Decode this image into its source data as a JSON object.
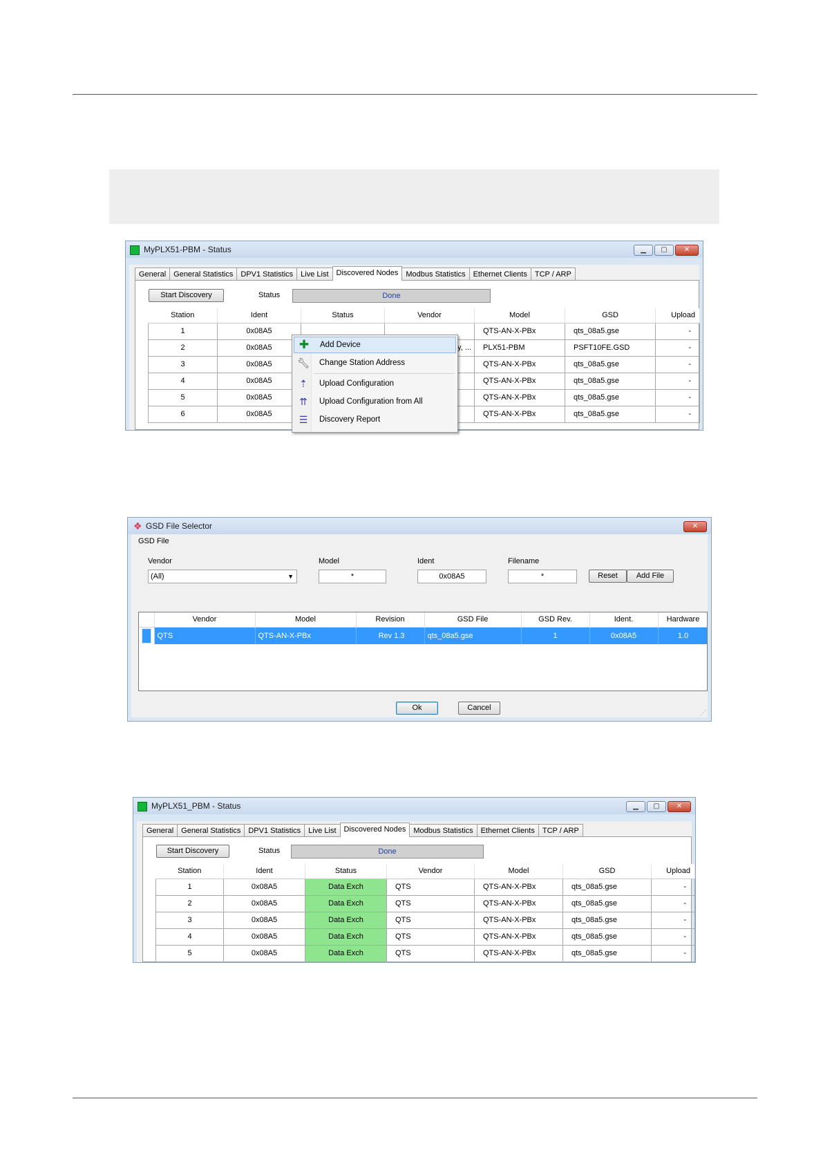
{
  "win1": {
    "title": "MyPLX51-PBM - Status",
    "tabs": [
      "General",
      "General Statistics",
      "DPV1 Statistics",
      "Live List",
      "Discovered Nodes",
      "Modbus Statistics",
      "Ethernet Clients",
      "TCP / ARP"
    ],
    "active_tab": "Discovered Nodes",
    "start_discovery_label": "Start Discovery",
    "status_label": "Status",
    "status_value": "Done",
    "columns": [
      "Station",
      "Ident",
      "Status",
      "Vendor",
      "Model",
      "GSD",
      "Upload"
    ],
    "rows": [
      {
        "station": "1",
        "ident": "0x08A5",
        "status": "",
        "vendor": "",
        "model": "QTS-AN-X-PBx",
        "gsd": "qts_08a5.gse",
        "upload": "-"
      },
      {
        "station": "2",
        "ident": "0x08A5",
        "status": "",
        "vendor": "gy, ...",
        "model": "PLX51-PBM",
        "gsd": "PSFT10FE.GSD",
        "upload": "-"
      },
      {
        "station": "3",
        "ident": "0x08A5",
        "status": "",
        "vendor": "",
        "model": "QTS-AN-X-PBx",
        "gsd": "qts_08a5.gse",
        "upload": "-"
      },
      {
        "station": "4",
        "ident": "0x08A5",
        "status": "",
        "vendor": "",
        "model": "QTS-AN-X-PBx",
        "gsd": "qts_08a5.gse",
        "upload": "-"
      },
      {
        "station": "5",
        "ident": "0x08A5",
        "status": "",
        "vendor": "",
        "model": "QTS-AN-X-PBx",
        "gsd": "qts_08a5.gse",
        "upload": "-"
      },
      {
        "station": "6",
        "ident": "0x08A5",
        "status": "",
        "vendor": "",
        "model": "QTS-AN-X-PBx",
        "gsd": "qts_08a5.gse",
        "upload": "-"
      }
    ],
    "context_menu": [
      {
        "label": "Add Device",
        "icon": "green-plus-icon"
      },
      {
        "label": "Change Station Address",
        "icon": "wrench-icon"
      },
      {
        "label": "Upload Configuration",
        "icon": "upload-icon"
      },
      {
        "label": "Upload Configuration from All",
        "icon": "upload-all-icon"
      },
      {
        "label": "Discovery Report",
        "icon": "report-icon"
      }
    ]
  },
  "gsd": {
    "title": "GSD File Selector",
    "group_label": "GSD File",
    "vendor_label": "Vendor",
    "vendor_value": "(All)",
    "model_label": "Model",
    "model_value": "*",
    "ident_label": "Ident",
    "ident_value": "0x08A5",
    "filename_label": "Filename",
    "filename_value": "*",
    "reset_label": "Reset",
    "add_file_label": "Add File",
    "columns": [
      "Vendor",
      "Model",
      "Revision",
      "GSD File",
      "GSD Rev.",
      "Ident.",
      "Hardware"
    ],
    "rows": [
      {
        "vendor": "QTS",
        "model": "QTS-AN-X-PBx",
        "revision": "Rev 1.3",
        "gsd_file": "qts_08a5.gse",
        "gsd_rev": "1",
        "ident": "0x08A5",
        "hardware": "1.0"
      }
    ],
    "ok_label": "Ok",
    "cancel_label": "Cancel"
  },
  "win2": {
    "title": "MyPLX51_PBM - Status",
    "tabs": [
      "General",
      "General Statistics",
      "DPV1 Statistics",
      "Live List",
      "Discovered Nodes",
      "Modbus Statistics",
      "Ethernet Clients",
      "TCP / ARP"
    ],
    "active_tab": "Discovered Nodes",
    "start_discovery_label": "Start Discovery",
    "status_label": "Status",
    "status_value": "Done",
    "columns": [
      "Station",
      "Ident",
      "Status",
      "Vendor",
      "Model",
      "GSD",
      "Upload"
    ],
    "rows": [
      {
        "station": "1",
        "ident": "0x08A5",
        "status": "Data Exch",
        "vendor": "QTS",
        "model": "QTS-AN-X-PBx",
        "gsd": "qts_08a5.gse",
        "upload": "-"
      },
      {
        "station": "2",
        "ident": "0x08A5",
        "status": "Data Exch",
        "vendor": "QTS",
        "model": "QTS-AN-X-PBx",
        "gsd": "qts_08a5.gse",
        "upload": "-"
      },
      {
        "station": "3",
        "ident": "0x08A5",
        "status": "Data Exch",
        "vendor": "QTS",
        "model": "QTS-AN-X-PBx",
        "gsd": "qts_08a5.gse",
        "upload": "-"
      },
      {
        "station": "4",
        "ident": "0x08A5",
        "status": "Data Exch",
        "vendor": "QTS",
        "model": "QTS-AN-X-PBx",
        "gsd": "qts_08a5.gse",
        "upload": "-"
      },
      {
        "station": "5",
        "ident": "0x08A5",
        "status": "Data Exch",
        "vendor": "QTS",
        "model": "QTS-AN-X-PBx",
        "gsd": "qts_08a5.gse",
        "upload": "-"
      }
    ]
  },
  "colors": {
    "data_exch_status": "#8fe58d",
    "selection": "#3399ff",
    "status_done_text": "#1f3fa0"
  }
}
